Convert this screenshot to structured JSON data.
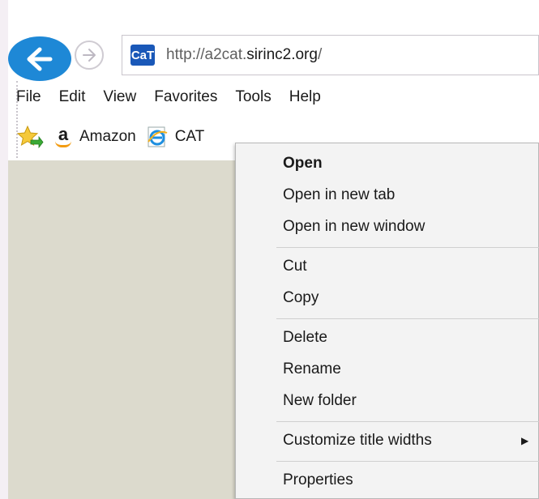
{
  "browser": {
    "url_prefix": "http://a2cat.",
    "url_host": "sirinc2.org",
    "url_suffix": "/",
    "site_icon_text": "CaT"
  },
  "menubar": {
    "items": [
      "File",
      "Edit",
      "View",
      "Favorites",
      "Tools",
      "Help"
    ]
  },
  "favorites": {
    "items": [
      {
        "label": "Amazon",
        "icon": "amazon-icon"
      },
      {
        "label": "CAT",
        "icon": "ie-icon"
      }
    ]
  },
  "context_menu": {
    "open": "Open",
    "open_new_tab": "Open in new tab",
    "open_new_window": "Open in new window",
    "cut": "Cut",
    "copy": "Copy",
    "delete": "Delete",
    "rename": "Rename",
    "new_folder": "New folder",
    "customize": "Customize title widths",
    "properties": "Properties"
  },
  "colors": {
    "back_button": "#1e88d6",
    "content_bg": "#dcdacd",
    "menu_bg": "#f3f3f3"
  }
}
